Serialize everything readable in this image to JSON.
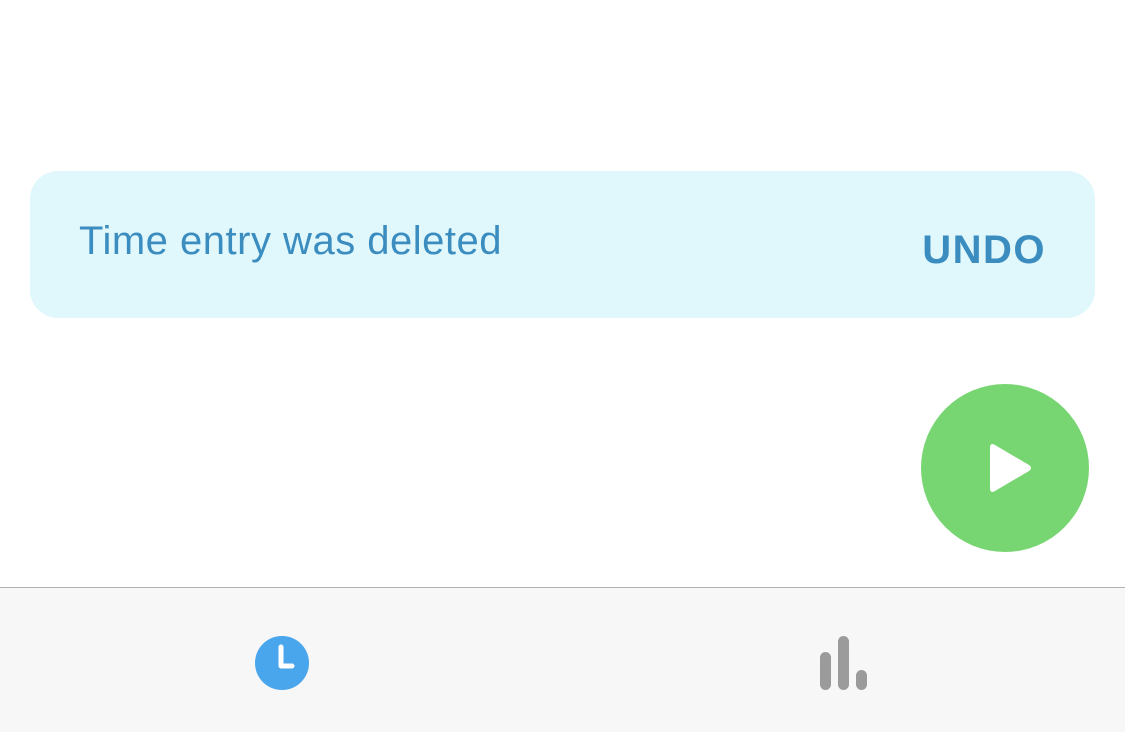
{
  "snackbar": {
    "message": "Time entry was deleted",
    "action_label": "UNDO"
  },
  "fab": {
    "icon": "play-icon",
    "color": "#78d672"
  },
  "tabbar": {
    "tabs": [
      {
        "name": "timer",
        "icon": "clock-icon",
        "selected": true,
        "color": "#4aa6ec"
      },
      {
        "name": "reports",
        "icon": "bar-chart-icon",
        "selected": false,
        "color": "#9b9b9b"
      }
    ]
  },
  "colors": {
    "snackbar_bg": "#e0f7fc",
    "snackbar_text": "#3b8dc0",
    "tabbar_bg": "#f7f7f7"
  }
}
